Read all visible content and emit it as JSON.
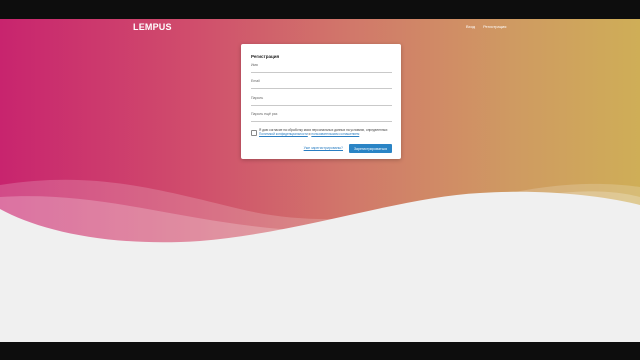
{
  "header": {
    "brand": "LEMPUS",
    "nav": {
      "login": "Вход",
      "register": "Регистрация"
    }
  },
  "form": {
    "title": "Регистрация",
    "fields": {
      "name": {
        "label": "Имя",
        "value": ""
      },
      "email": {
        "label": "Email",
        "value": ""
      },
      "password": {
        "label": "Пароль",
        "value": ""
      },
      "password_confirm": {
        "label": "Пароль ещё раз",
        "value": ""
      }
    },
    "consent": {
      "text": "Я даю согласие на обработку моих персональных данных на условиях, определенных",
      "privacy_link": "Политикой конфиденциальности",
      "conjunction": "и",
      "agreement_link": "пользовательским соглашением",
      "checked": false
    },
    "login_link": "Уже зарегистрированы?",
    "submit_label": "Зарегистрироваться"
  },
  "colors": {
    "gradient_start": "#c8246e",
    "gradient_end": "#cfae57",
    "accent": "#2a84c5",
    "page_background": "#f0f0f0"
  }
}
